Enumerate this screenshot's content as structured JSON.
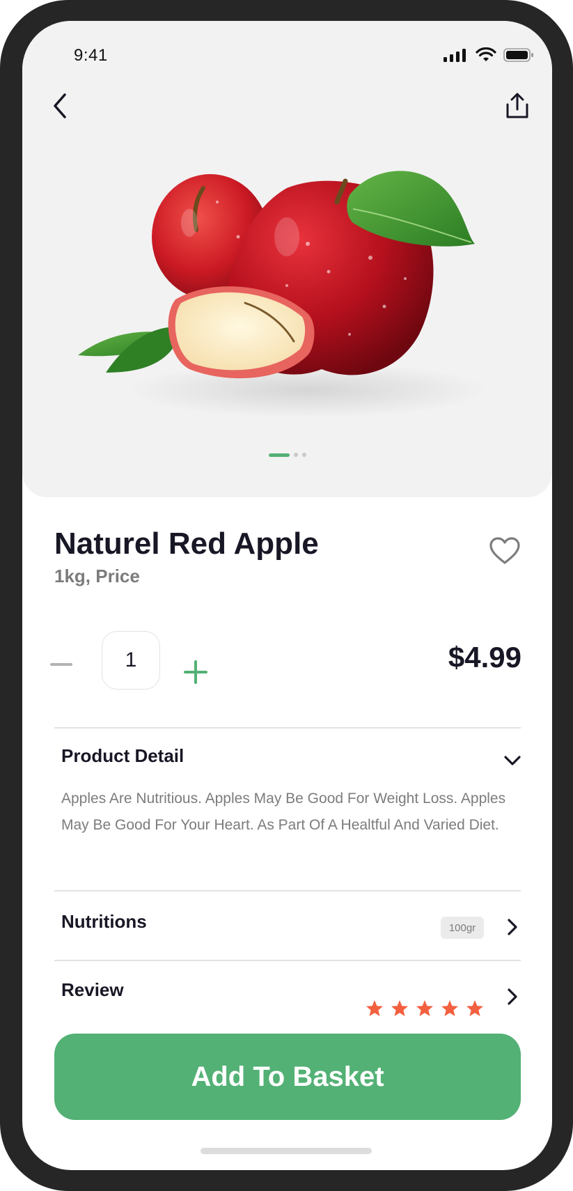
{
  "status_bar": {
    "time": "9:41"
  },
  "product": {
    "name": "Naturel Red Apple",
    "unit_price_label": "1kg, Price",
    "quantity": "1",
    "price": "$4.99"
  },
  "gallery": {
    "total_images": 3,
    "active_index": 0
  },
  "detail": {
    "heading": "Product Detail",
    "text": "Apples Are Nutritious. Apples May Be Good For Weight Loss. Apples May Be Good For Your Heart. As Part Of A Healtful And Varied Diet."
  },
  "nutritions": {
    "label": "Nutritions",
    "badge": "100gr"
  },
  "review": {
    "label": "Review",
    "rating": 5,
    "max_rating": 5
  },
  "cta": {
    "label": "Add To Basket"
  },
  "colors": {
    "accent": "#53b175",
    "star": "#f3603f",
    "title": "#181725",
    "muted": "#7c7c7c"
  },
  "icons": [
    "back-arrow-icon",
    "share-icon",
    "heart-icon",
    "chevron-down-icon",
    "chevron-right-icon",
    "star-icon",
    "signal-icon",
    "wifi-icon",
    "battery-icon"
  ]
}
